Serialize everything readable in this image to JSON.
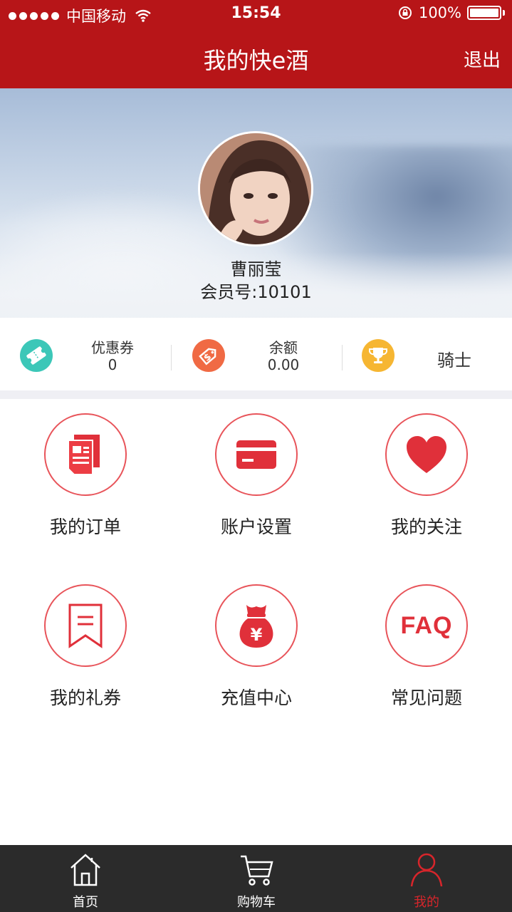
{
  "status_bar": {
    "carrier": "中国移动",
    "time": "15:54",
    "battery": "100%"
  },
  "nav": {
    "title": "我的快e酒",
    "logout": "退出"
  },
  "profile": {
    "name": "曹丽莹",
    "member_no": "会员号:10101"
  },
  "stats": {
    "coupons": {
      "label": "优惠券",
      "value": "0",
      "icon": "ticket-icon",
      "color": "#3cc7b8"
    },
    "balance": {
      "label": "余额",
      "value": "0.00",
      "icon": "money-tag-icon",
      "color": "#f06a44"
    },
    "level": {
      "value": "骑士",
      "icon": "trophy-icon",
      "color": "#f6b632"
    }
  },
  "menu": [
    {
      "label": "我的订单",
      "icon": "orders-icon"
    },
    {
      "label": "账户设置",
      "icon": "card-icon"
    },
    {
      "label": "我的关注",
      "icon": "heart-icon"
    },
    {
      "label": "我的礼券",
      "icon": "bookmark-icon"
    },
    {
      "label": "充值中心",
      "icon": "money-bag-icon"
    },
    {
      "label": "常见问题",
      "icon": "faq-icon",
      "icon_text": "FAQ"
    }
  ],
  "tabs": [
    {
      "label": "首页",
      "icon": "home-icon",
      "active": false
    },
    {
      "label": "购物车",
      "icon": "cart-icon",
      "active": false
    },
    {
      "label": "我的",
      "icon": "user-icon",
      "active": true
    }
  ],
  "colors": {
    "brand_red": "#b71518",
    "accent_red": "#e0303a",
    "tabbar_bg": "#2b2b2b"
  }
}
